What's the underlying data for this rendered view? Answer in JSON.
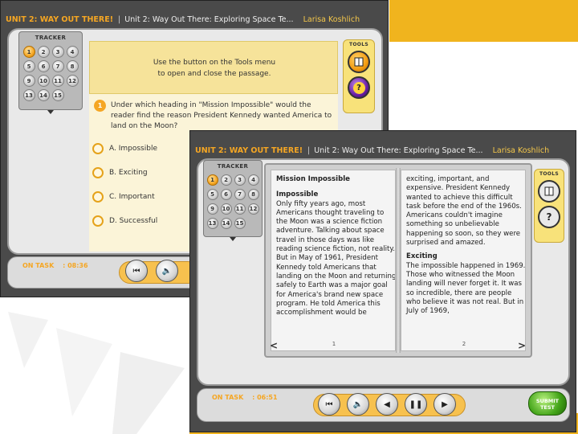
{
  "colors": {
    "accent": "#f0b41e",
    "orange": "#f5a623",
    "panel": "#fbf4d8"
  },
  "back": {
    "titlebar": {
      "unit": "UNIT 2: WAY OUT THERE!",
      "title": "Unit 2: Way Out There:  Exploring Space  Te...",
      "student": "Larisa Koshlich"
    },
    "tracker": {
      "label": "TRACKER",
      "items": [
        "1",
        "2",
        "3",
        "4",
        "5",
        "6",
        "7",
        "8",
        "9",
        "10",
        "11",
        "12",
        "13",
        "14",
        "15"
      ]
    },
    "instruction": {
      "line1": "Use the button on the Tools menu",
      "line2": "to open and close the passage."
    },
    "question": {
      "number": "1",
      "text": "Under which heading in \"Mission Impossible\" would the reader find the reason President Kennedy wanted America to land on the Moon?"
    },
    "choices": [
      {
        "label": "A.  Impossible"
      },
      {
        "label": "B.  Exciting"
      },
      {
        "label": "C.  Important"
      },
      {
        "label": "D.  Successful"
      }
    ],
    "tools": {
      "label": "TOOLS"
    },
    "ontask": {
      "label": "ON TASK",
      "time": ": 08:36"
    }
  },
  "front": {
    "titlebar": {
      "unit": "UNIT 2: WAY OUT THERE!",
      "title": "Unit 2: Way Out There:  Exploring Space  Te...",
      "student": "Larisa Koshlich"
    },
    "tracker": {
      "label": "TRACKER",
      "items": [
        "1",
        "2",
        "3",
        "4",
        "5",
        "6",
        "7",
        "8",
        "9",
        "10",
        "11",
        "12",
        "13",
        "14",
        "15"
      ]
    },
    "passage": {
      "title": "Mission Impossible",
      "left_heading": "Impossible",
      "left_text": "Only fifty years ago, most Americans thought traveling to the Moon was a science fiction adventure. Talking about space travel in those days was like reading science fiction, not reality. But in May of 1961, President Kennedy told Americans that landing on the Moon and returning safely to Earth was a major goal for America's brand new space program. He told America this accomplishment would be",
      "right_text": "exciting, important, and expensive. President Kennedy wanted to achieve this difficult task before the end of the 1960s. Americans couldn't imagine something so unbelievable happening so soon, so they were surprised and amazed.",
      "right_heading": "Exciting",
      "right_text2": "The impossible happened in 1969. Those who witnessed the Moon landing will never forget it. It was so incredible, there are people who believe it was not real. But in July of 1969,",
      "page_left": "1",
      "page_right": "2",
      "nav_prev": "<",
      "nav_next": ">"
    },
    "tools": {
      "label": "TOOLS"
    },
    "ontask": {
      "label": "ON TASK",
      "time": ": 06:51"
    },
    "submit": {
      "line1": "SUBMIT",
      "line2": "TEST"
    }
  }
}
